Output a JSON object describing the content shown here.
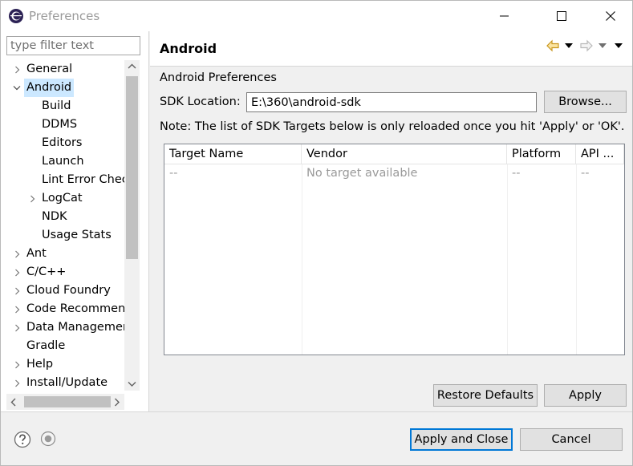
{
  "window": {
    "title": "Preferences"
  },
  "filter": {
    "placeholder": "type filter text"
  },
  "tree": {
    "items": [
      {
        "label": "General",
        "chevron": "right"
      },
      {
        "label": "Android",
        "chevron": "down",
        "selected": true
      },
      {
        "label": "Build",
        "chevron": "none"
      },
      {
        "label": "DDMS",
        "chevron": "none"
      },
      {
        "label": "Editors",
        "chevron": "none"
      },
      {
        "label": "Launch",
        "chevron": "none"
      },
      {
        "label": "Lint Error Chec",
        "chevron": "none"
      },
      {
        "label": "LogCat",
        "chevron": "right"
      },
      {
        "label": "NDK",
        "chevron": "none"
      },
      {
        "label": "Usage Stats",
        "chevron": "none"
      },
      {
        "label": "Ant",
        "chevron": "right"
      },
      {
        "label": "C/C++",
        "chevron": "right"
      },
      {
        "label": "Cloud Foundry",
        "chevron": "right"
      },
      {
        "label": "Code Recommen",
        "chevron": "right"
      },
      {
        "label": "Data Managemen",
        "chevron": "right"
      },
      {
        "label": "Gradle",
        "chevron": "none"
      },
      {
        "label": "Help",
        "chevron": "right"
      },
      {
        "label": "Install/Update",
        "chevron": "right"
      }
    ]
  },
  "page": {
    "title": "Android",
    "section_label": "Android Preferences",
    "sdk_label": "SDK Location:",
    "sdk_value": "E:\\360\\android-sdk",
    "browse_label": "Browse...",
    "note": "Note: The list of SDK Targets below is only reloaded once you hit 'Apply' or 'OK'.",
    "table": {
      "columns": [
        "Target Name",
        "Vendor",
        "Platform",
        "API ..."
      ],
      "rows": [
        [
          "--",
          "No target available",
          "--",
          "--"
        ]
      ]
    },
    "restore_label": "Restore Defaults",
    "apply_label": "Apply"
  },
  "footer": {
    "apply_close_label": "Apply and Close",
    "cancel_label": "Cancel"
  },
  "colors": {
    "selection": "#cce8ff",
    "accent": "#0078d7",
    "nav_back_arrow": "#e8b93a"
  }
}
